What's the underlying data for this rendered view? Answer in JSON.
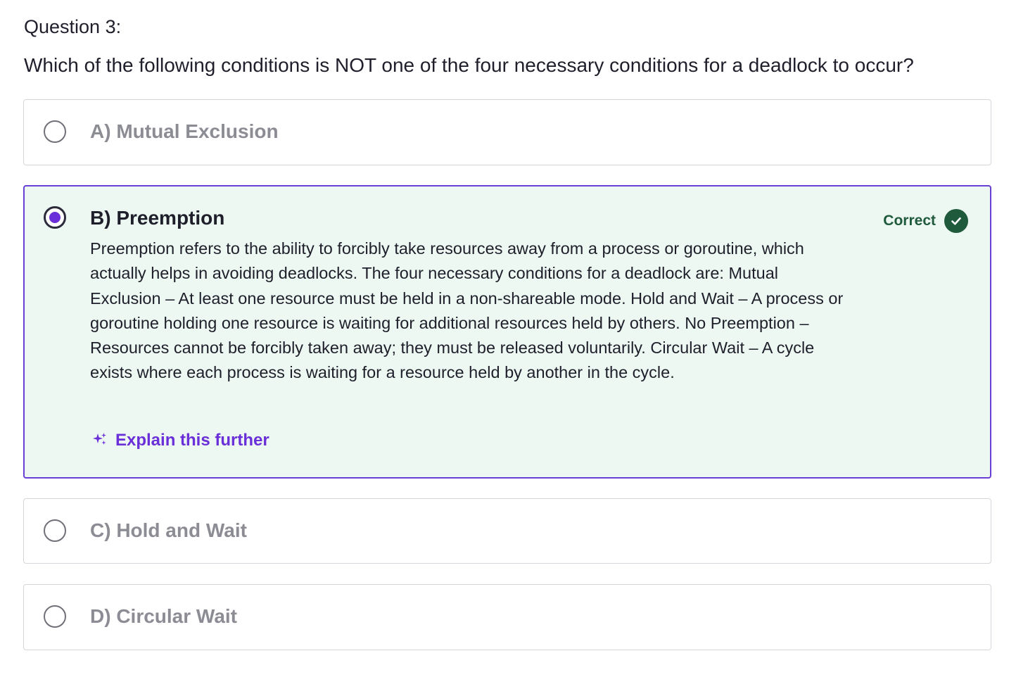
{
  "question": {
    "label": "Question 3:",
    "text": "Which of the following conditions is NOT one of the four necessary conditions for a deadlock to occur?"
  },
  "options": [
    {
      "label": "A) Mutual Exclusion",
      "selected": false
    },
    {
      "label": "B) Preemption",
      "selected": true,
      "status": "Correct",
      "explanation": "Preemption refers to the ability to forcibly take resources away from a process or goroutine, which actually helps in avoiding deadlocks. The four necessary conditions for a deadlock are: Mutual Exclusion – At least one resource must be held in a non-shareable mode. Hold and Wait – A process or goroutine holding one resource is waiting for additional resources held by others. No Preemption – Resources cannot be forcibly taken away; they must be released voluntarily. Circular Wait – A cycle exists where each process is waiting for a resource held by another in the cycle.",
      "explain_link": "Explain this further"
    },
    {
      "label": "C) Hold and Wait",
      "selected": false
    },
    {
      "label": "D) Circular Wait",
      "selected": false
    }
  ],
  "colors": {
    "accent": "#6a2fd9",
    "correct": "#1f5a3c",
    "selected_bg": "#ecf8f1",
    "unselected_text": "#8c8c94"
  },
  "icons": {
    "status": "check-circle-icon",
    "explain": "sparkle-icon"
  }
}
